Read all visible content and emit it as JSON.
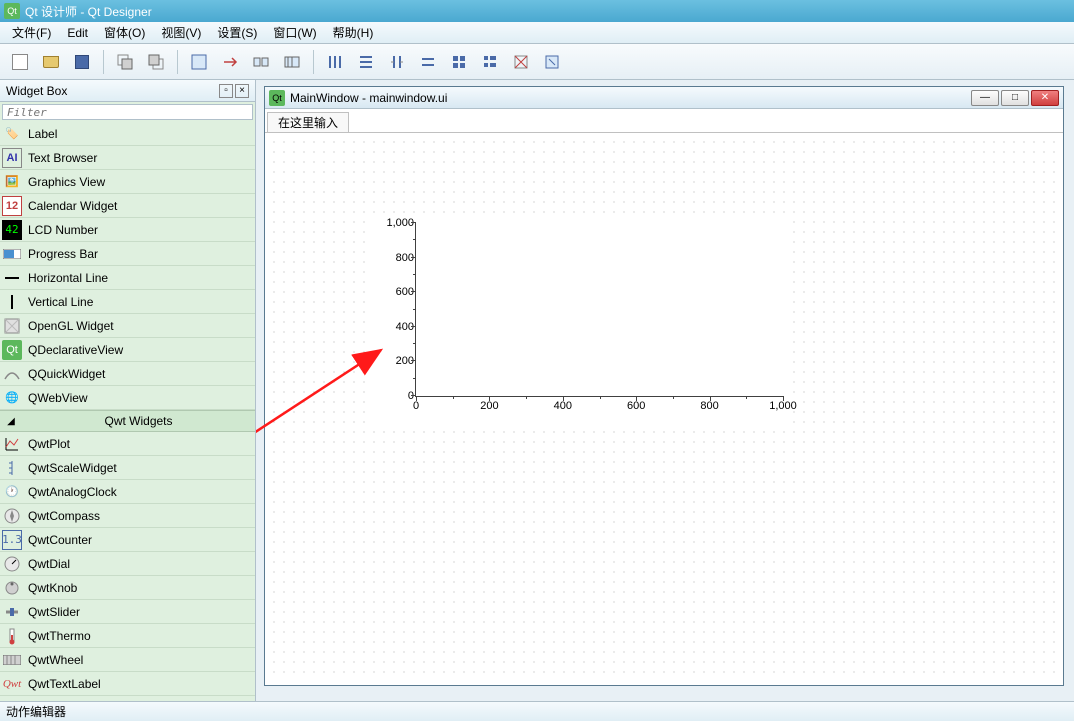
{
  "window": {
    "title": "Qt 设计师 - Qt Designer"
  },
  "menu": {
    "file": "文件(F)",
    "edit": "Edit",
    "form": "窗体(O)",
    "view": "视图(V)",
    "settings": "设置(S)",
    "window": "窗口(W)",
    "help": "帮助(H)"
  },
  "panels": {
    "widgetbox": "Widget Box",
    "filter_placeholder": "Filter",
    "actioneditor": "动作编辑器"
  },
  "widgets": {
    "label": "Label",
    "textbrowser": "Text Browser",
    "graphicsview": "Graphics View",
    "calendar": "Calendar Widget",
    "lcd": "LCD Number",
    "progress": "Progress Bar",
    "hline": "Horizontal Line",
    "vline": "Vertical Line",
    "opengl": "OpenGL Widget",
    "qdecl": "QDeclarativeView",
    "qquick": "QQuickWidget",
    "qweb": "QWebView",
    "group_qwt": "Qwt Widgets",
    "qwtplot": "QwtPlot",
    "qwtscale": "QwtScaleWidget",
    "qwtanalog": "QwtAnalogClock",
    "qwtcompass": "QwtCompass",
    "qwtcounter": "QwtCounter",
    "qwtdial": "QwtDial",
    "qwtknob": "QwtKnob",
    "qwtslider": "QwtSlider",
    "qwtthermo": "QwtThermo",
    "qwtwheel": "QwtWheel",
    "qwttext": "QwtTextLabel"
  },
  "designer": {
    "window_title": "MainWindow - mainwindow.ui",
    "type_here": "在这里输入"
  },
  "chart_data": {
    "type": "scatter",
    "title": "",
    "xlabel": "",
    "ylabel": "",
    "xlim": [
      0,
      1000
    ],
    "ylim": [
      0,
      1000
    ],
    "x_ticks": [
      0,
      200,
      400,
      600,
      800,
      1000
    ],
    "y_ticks": [
      0,
      200,
      400,
      600,
      800,
      1000
    ],
    "x_tick_labels": [
      "0",
      "200",
      "400",
      "600",
      "800",
      "1,000"
    ],
    "y_tick_labels": [
      "0",
      "200",
      "400",
      "600",
      "800",
      "1,000"
    ],
    "series": []
  }
}
